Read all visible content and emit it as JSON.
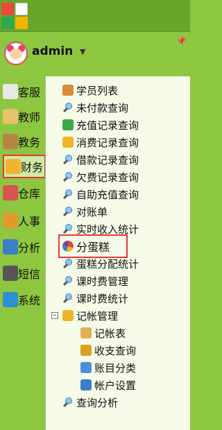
{
  "user": {
    "name": "admin",
    "dropdown_icon": "caret-down-icon"
  },
  "pin_icon": "pin-icon",
  "left_nav": [
    {
      "label": "客服",
      "icon": "document-icon",
      "color": "#e8e8e8"
    },
    {
      "label": "教师",
      "icon": "scroll-icon",
      "color": "#e8c16a"
    },
    {
      "label": "教务",
      "icon": "books-icon",
      "color": "#b88444"
    },
    {
      "label": "财务",
      "icon": "treasure-icon",
      "color": "#f3b530",
      "active": true
    },
    {
      "label": "仓库",
      "icon": "house-icon",
      "color": "#d9534f"
    },
    {
      "label": "人事",
      "icon": "person-badge-icon",
      "color": "#e09a2c"
    },
    {
      "label": "分析",
      "icon": "bar-chart-icon",
      "color": "#3b7fc4"
    },
    {
      "label": "短信",
      "icon": "phone-icon",
      "color": "#555555"
    },
    {
      "label": "系统",
      "icon": "system-window-icon",
      "color": "#2f8fd0"
    }
  ],
  "tree": [
    {
      "label": "学员列表",
      "icon": "students-icon"
    },
    {
      "label": "未付款查询",
      "icon": "search-icon"
    },
    {
      "label": "充值记录查询",
      "icon": "green-arrow-icon"
    },
    {
      "label": "消费记录查询",
      "icon": "yellow-arrow-icon"
    },
    {
      "label": "借款记录查询",
      "icon": "search-icon"
    },
    {
      "label": "欠费记录查询",
      "icon": "search-icon"
    },
    {
      "label": "自助充值查询",
      "icon": "search-icon"
    },
    {
      "label": "对账单",
      "icon": "search-icon"
    },
    {
      "label": "实时收入统计",
      "icon": "search-icon"
    },
    {
      "label": "分蛋糕",
      "icon": "pie-chart-icon",
      "highlighted": true
    },
    {
      "label": "蛋糕分配统计",
      "icon": "search-icon"
    },
    {
      "label": "课时费管理",
      "icon": "search-icon"
    },
    {
      "label": "课时费统计",
      "icon": "search-icon"
    },
    {
      "label": "记帐管理",
      "icon": "folder-icon",
      "expander": "−"
    },
    {
      "label": "记帐表",
      "icon": "ledger-icon",
      "indent": 1
    },
    {
      "label": "收支查询",
      "icon": "coins-icon",
      "indent": 1
    },
    {
      "label": "账目分类",
      "icon": "category-icon",
      "indent": 1
    },
    {
      "label": "帐户设置",
      "icon": "account-settings-icon",
      "indent": 1
    },
    {
      "label": "查询分析",
      "icon": "search-icon"
    }
  ],
  "colors": {
    "green_bg": "#8dc63f",
    "tree_bg": "#f6fbe9",
    "highlight": "#e53935"
  }
}
